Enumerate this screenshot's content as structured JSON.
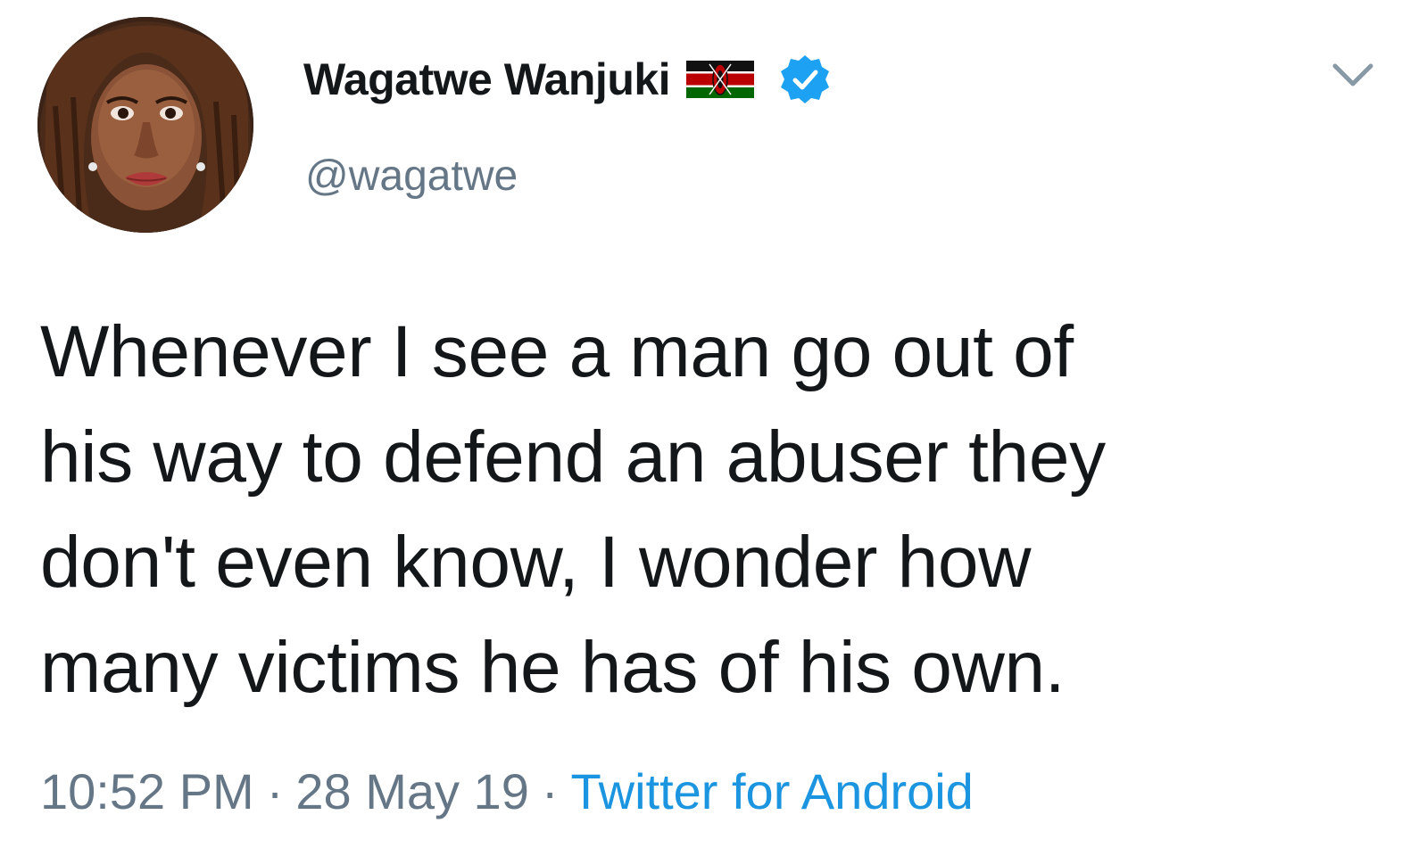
{
  "author": {
    "display_name": "Wagatwe Wanjuki",
    "handle": "@wagatwe",
    "avatar_icon": "profile-photo",
    "flag_icon": "kenya-flag-icon",
    "verified_icon": "verified-badge-icon"
  },
  "tweet": {
    "text_lines": [
      "Whenever I see a man go out of",
      "his way to defend an abuser they",
      "don't even know, I wonder how",
      "many victims he has of his own."
    ],
    "time": "10:52 PM",
    "date": "28 May 19",
    "separator": "·",
    "source": "Twitter for Android"
  },
  "menu": {
    "icon": "chevron-down-icon"
  },
  "colors": {
    "text": "#14171a",
    "secondary": "#657786",
    "link": "#1b95e0",
    "verified": "#1da1f2"
  }
}
